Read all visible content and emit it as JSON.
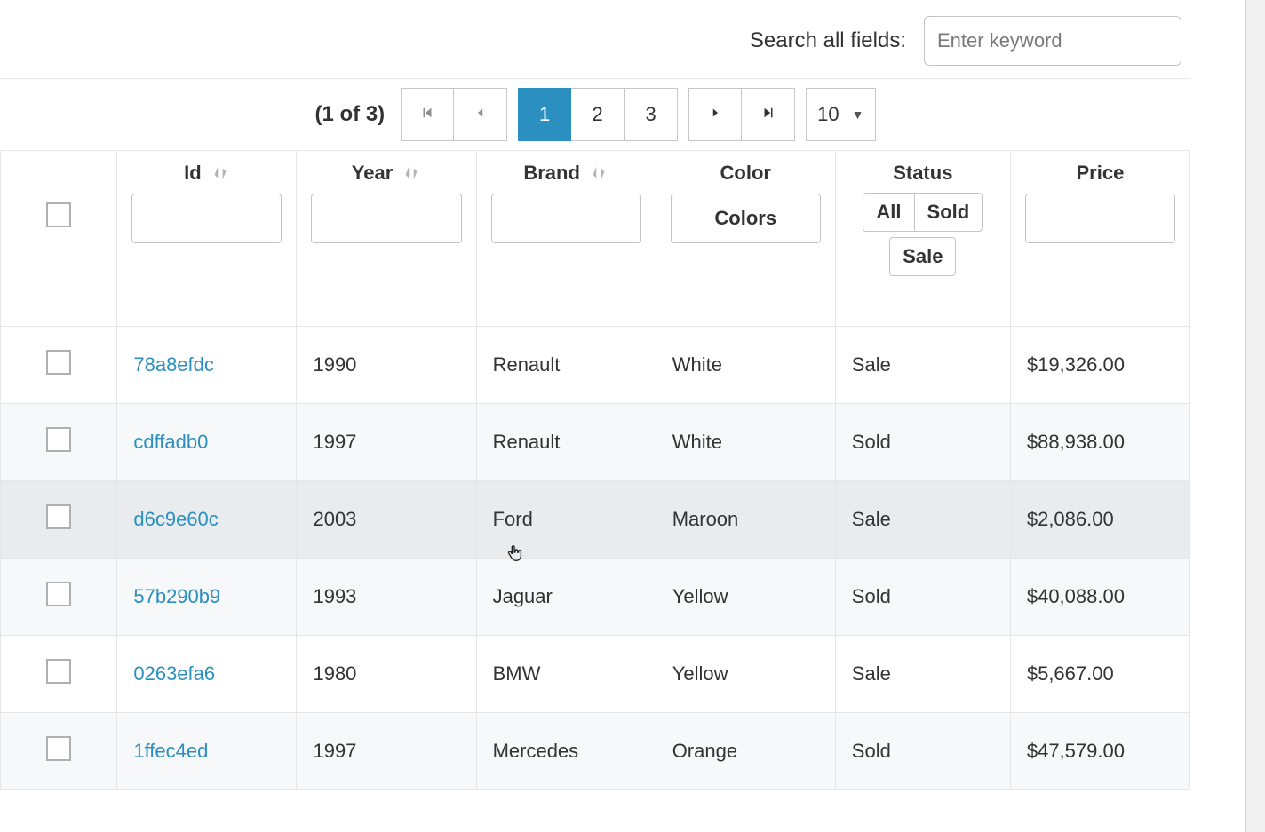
{
  "search": {
    "label": "Search all fields:",
    "placeholder": "Enter keyword",
    "value": ""
  },
  "paginator": {
    "info": "(1 of 3)",
    "pages": [
      "1",
      "2",
      "3"
    ],
    "active_page_index": 0,
    "rows_per_page": "10"
  },
  "columns": {
    "id": {
      "header": "Id",
      "filter_value": ""
    },
    "year": {
      "header": "Year",
      "filter_value": ""
    },
    "brand": {
      "header": "Brand",
      "filter_value": ""
    },
    "color": {
      "header": "Color",
      "filter_label": "Colors"
    },
    "status": {
      "header": "Status",
      "options": [
        "All",
        "Sold",
        "Sale"
      ]
    },
    "price": {
      "header": "Price",
      "filter_value": ""
    }
  },
  "rows": [
    {
      "id": "78a8efdc",
      "year": "1990",
      "brand": "Renault",
      "color": "White",
      "status": "Sale",
      "price": "$19,326.00"
    },
    {
      "id": "cdffadb0",
      "year": "1997",
      "brand": "Renault",
      "color": "White",
      "status": "Sold",
      "price": "$88,938.00"
    },
    {
      "id": "d6c9e60c",
      "year": "2003",
      "brand": "Ford",
      "color": "Maroon",
      "status": "Sale",
      "price": "$2,086.00"
    },
    {
      "id": "57b290b9",
      "year": "1993",
      "brand": "Jaguar",
      "color": "Yellow",
      "status": "Sold",
      "price": "$40,088.00"
    },
    {
      "id": "0263efa6",
      "year": "1980",
      "brand": "BMW",
      "color": "Yellow",
      "status": "Sale",
      "price": "$5,667.00"
    },
    {
      "id": "1ffec4ed",
      "year": "1997",
      "brand": "Mercedes",
      "color": "Orange",
      "status": "Sold",
      "price": "$47,579.00"
    }
  ],
  "hovered_row_index": 2
}
